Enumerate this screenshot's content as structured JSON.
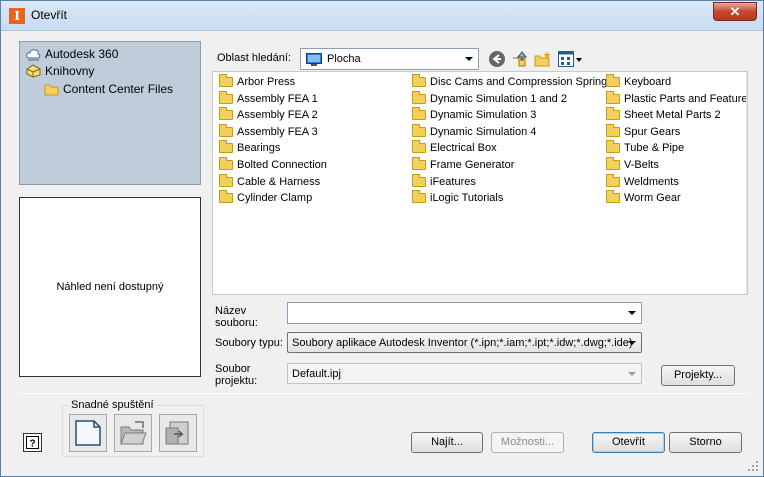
{
  "window": {
    "title": "Otevřít",
    "close_glyph": "✕"
  },
  "locations": [
    {
      "label": "Autodesk 360",
      "icon": "cloud-icon"
    },
    {
      "label": "Knihovny",
      "icon": "library-icon"
    },
    {
      "label": "Content Center Files",
      "icon": "folder-icon"
    }
  ],
  "preview": {
    "text": "Náhled není dostupný"
  },
  "lookin": {
    "label": "Oblast hledání:",
    "value": "Plocha"
  },
  "files": {
    "col1": [
      "Arbor Press",
      "Assembly FEA 1",
      "Assembly FEA 2",
      "Assembly FEA 3",
      "Bearings",
      "Bolted Connection",
      "Cable & Harness",
      "Cylinder Clamp"
    ],
    "col2": [
      "Disc Cams and Compression Springs",
      "Dynamic Simulation 1 and 2",
      "Dynamic Simulation 3",
      "Dynamic Simulation 4",
      "Electrical Box",
      "Frame Generator",
      "iFeatures",
      "iLogic Tutorials"
    ],
    "col3": [
      "Keyboard",
      "Plastic Parts and Features",
      "Sheet Metal Parts 2",
      "Spur Gears",
      "Tube & Pipe",
      "V-Belts",
      "Weldments",
      "Worm Gear"
    ]
  },
  "fields": {
    "filename_label_1": "Název",
    "filename_label_2": "souboru:",
    "filename_value": "",
    "filetype_label": "Soubory typu:",
    "filetype_value": "Soubory aplikace Autodesk Inventor (*.ipn;*.iam;*.ipt;*.idw;*.dwg;*.ide)",
    "project_label_1": "Soubor",
    "project_label_2": "projektu:",
    "project_value": "Default.ipj",
    "projects_button": "Projekty..."
  },
  "quick_launch": {
    "label": "Snadné spuštění"
  },
  "buttons": {
    "find": "Najít...",
    "options": "Možnosti...",
    "open": "Otevřít",
    "cancel": "Storno"
  }
}
